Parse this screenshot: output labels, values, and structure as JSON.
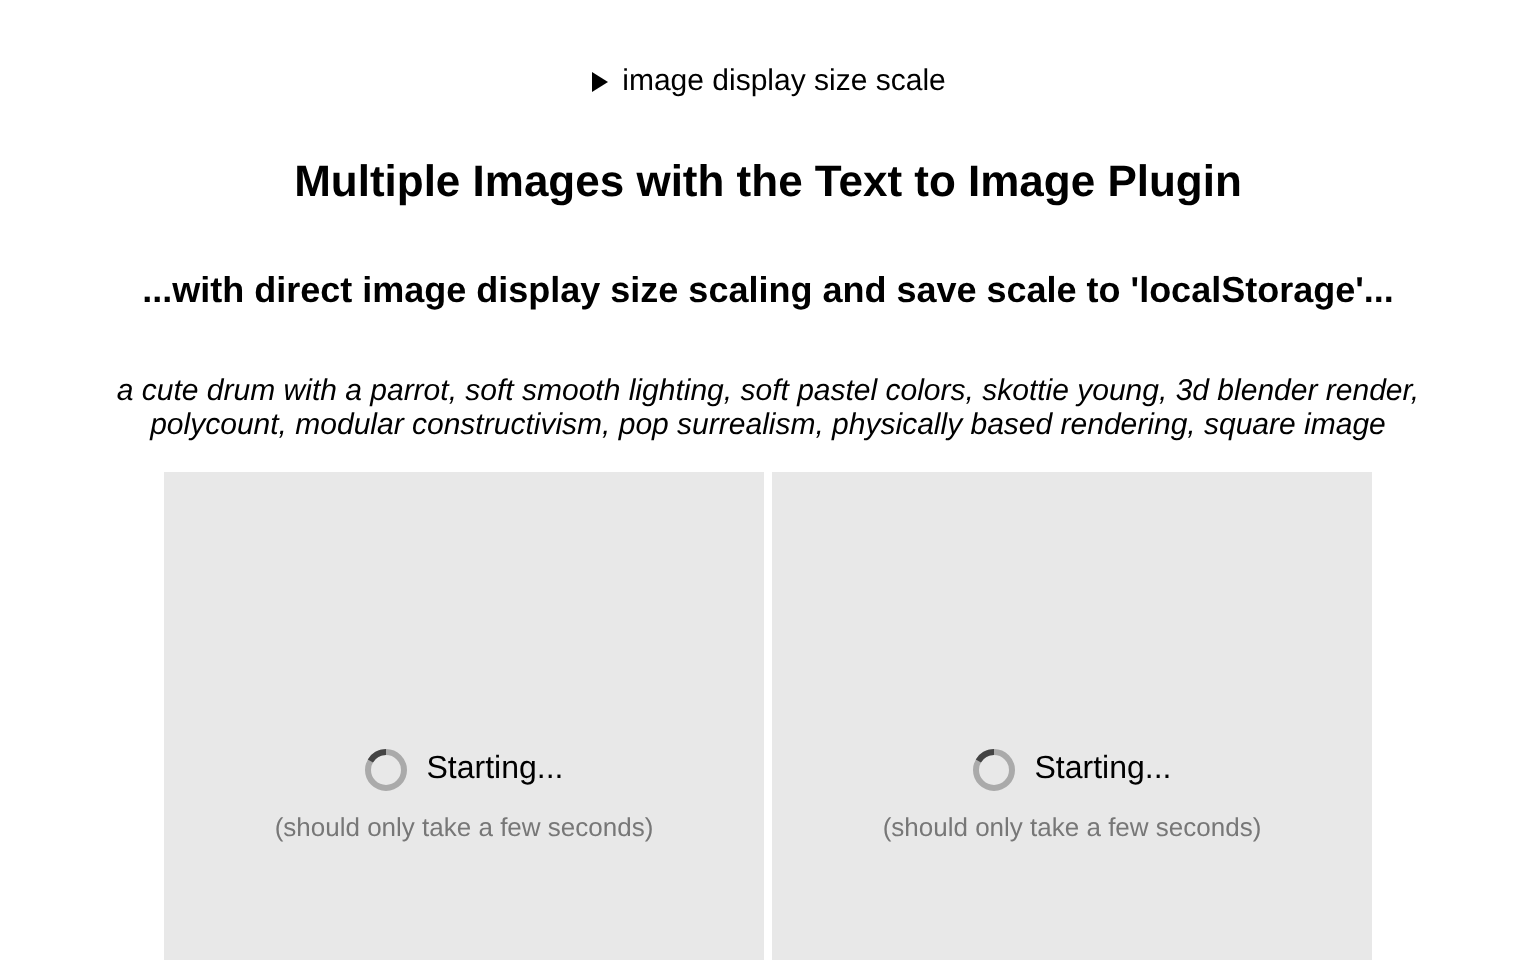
{
  "details": {
    "summary": "image display size scale",
    "expanded": false
  },
  "title": "Multiple Images with the Text to Image Plugin",
  "subtitle": "...with direct image display size scaling and save scale to 'localStorage'...",
  "prompt": "a cute drum with a parrot, soft smooth lighting, soft pastel colors, skottie young, 3d blender render, polycount, modular constructivism, pop surrealism, physically based rendering, square image",
  "images": [
    {
      "status": "Starting...",
      "note": "(should only take a few seconds)",
      "loading": true
    },
    {
      "status": "Starting...",
      "note": "(should only take a few seconds)",
      "loading": true
    }
  ]
}
